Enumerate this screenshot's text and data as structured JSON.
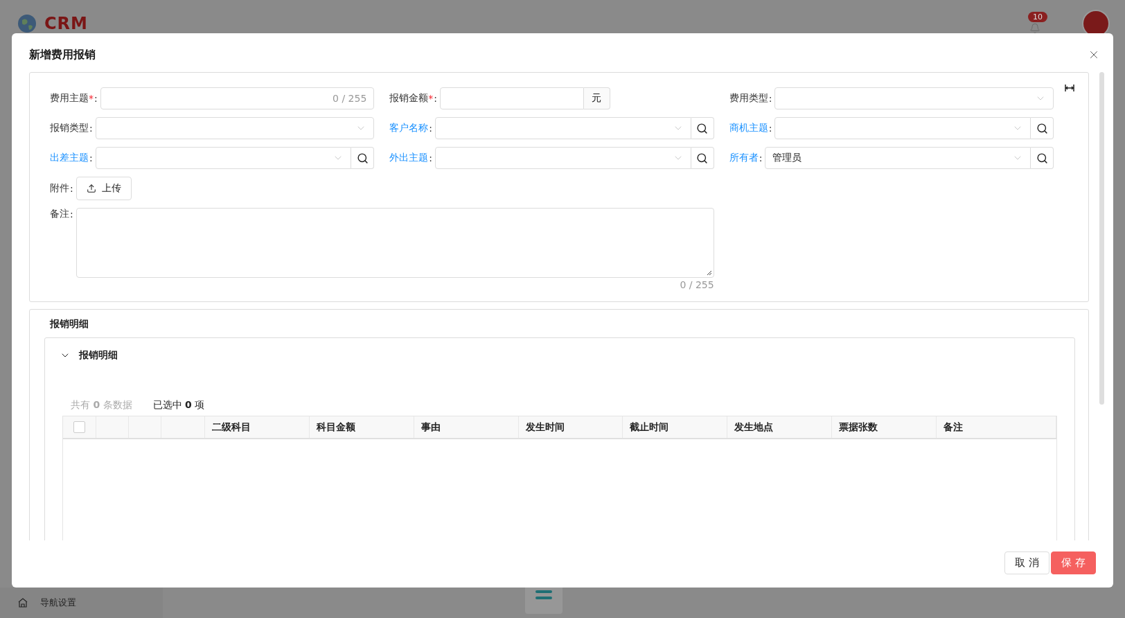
{
  "app": {
    "logo_text": "CRM",
    "notification_count": "10",
    "nav_settings": "导航设置"
  },
  "dialog": {
    "title": "新增费用报销",
    "form": {
      "label_colon": ":",
      "rows": [
        [
          {
            "kind": "counted",
            "label": "费用主题",
            "link": false,
            "required_mark": "*",
            "counter": "0 / 255"
          },
          {
            "kind": "amount",
            "label": "报销金额",
            "link": false,
            "required_mark": "*",
            "suffix": "元"
          },
          {
            "kind": "select",
            "label": "费用类型",
            "link": false
          }
        ],
        [
          {
            "kind": "select",
            "label": "报销类型",
            "link": false
          },
          {
            "kind": "lookup",
            "label": "客户名称",
            "link": true
          },
          {
            "kind": "lookup",
            "label": "商机主题",
            "link": true
          }
        ],
        [
          {
            "kind": "lookup",
            "label": "出差主题",
            "link": true
          },
          {
            "kind": "lookup",
            "label": "外出主题",
            "link": true
          },
          {
            "kind": "lookup",
            "label": "所有者",
            "link": true,
            "value": "管理员"
          }
        ]
      ],
      "attachment": {
        "label": "附件",
        "button": "上传"
      },
      "remark": {
        "label": "备注",
        "counter": "0 / 255"
      }
    },
    "detail": {
      "title": "报销明细",
      "section": {
        "title": "报销明细",
        "expanded": true,
        "total": "共有 **0** 条数据",
        "selected": "已选中 **0** 项",
        "columns": [
          {
            "kind": "checkbox",
            "checked": false
          },
          {
            "kind": "blank"
          },
          {
            "kind": "blank"
          },
          {
            "kind": "blank"
          },
          {
            "kind": "text",
            "label": "二级科目"
          },
          {
            "kind": "text",
            "label": "科目金额"
          },
          {
            "kind": "text",
            "label": "事由"
          },
          {
            "kind": "text",
            "label": "发生时间"
          },
          {
            "kind": "text",
            "label": "截止时间"
          },
          {
            "kind": "text",
            "label": "发生地点"
          },
          {
            "kind": "text",
            "label": "票据张数"
          },
          {
            "kind": "text",
            "label": "备注"
          }
        ]
      }
    },
    "buttons": [
      {
        "kind": "cancel",
        "label": "取 消"
      },
      {
        "kind": "primary",
        "label": "保 存"
      }
    ]
  }
}
